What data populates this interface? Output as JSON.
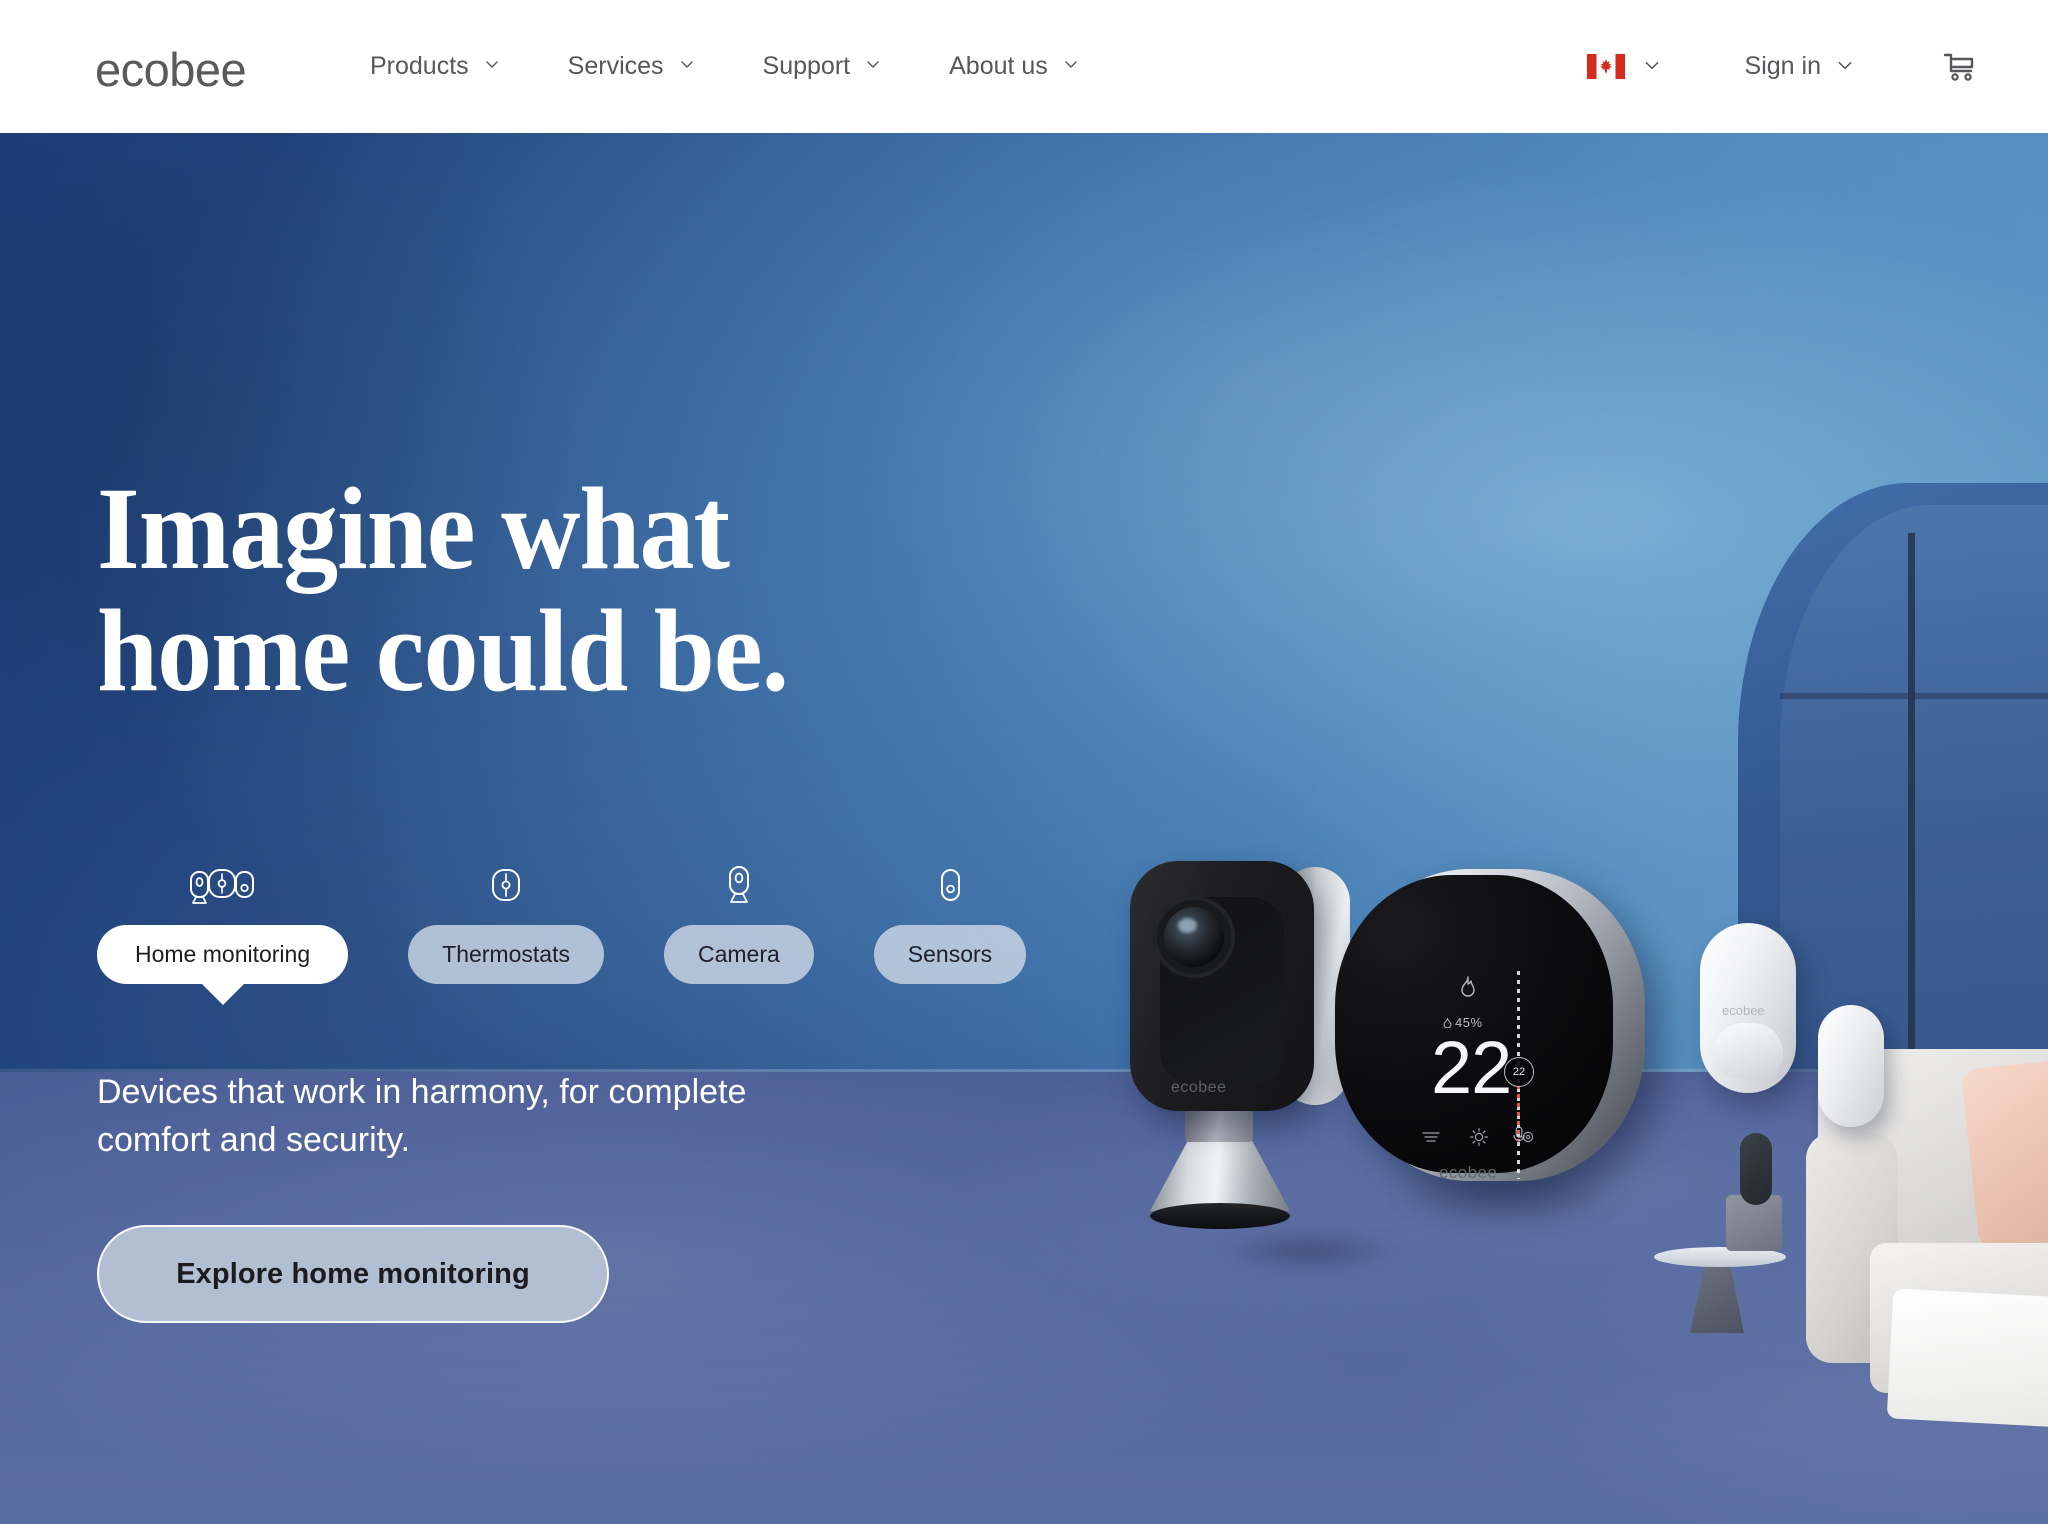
{
  "brand": {
    "name": "ecobee"
  },
  "header": {
    "nav": [
      {
        "label": "Products",
        "icon": "chevron-down-icon"
      },
      {
        "label": "Services",
        "icon": "chevron-down-icon"
      },
      {
        "label": "Support",
        "icon": "chevron-down-icon"
      },
      {
        "label": "About us",
        "icon": "chevron-down-icon"
      }
    ],
    "region": {
      "label": "Canada",
      "icon": "canada-flag-icon",
      "chevron": "chevron-down-icon"
    },
    "signin": {
      "label": "Sign in",
      "chevron": "chevron-down-icon"
    },
    "cart": {
      "icon": "shopping-cart-icon"
    }
  },
  "hero": {
    "headline": "Imagine what\nhome could be.",
    "subhead": "Devices that work in harmony, for complete\ncomfort and security.",
    "cta_label": "Explore home monitoring",
    "categories": [
      {
        "label": "Home monitoring",
        "icon": "home-monitoring-devices-icon",
        "active": true
      },
      {
        "label": "Thermostats",
        "icon": "thermostat-icon",
        "active": false
      },
      {
        "label": "Camera",
        "icon": "camera-icon",
        "active": false
      },
      {
        "label": "Sensors",
        "icon": "sensor-icon",
        "active": false
      }
    ]
  },
  "products": {
    "camera": {
      "name": "SmartCamera",
      "brand_text": "ecobee"
    },
    "thermostat": {
      "name": "Smart Thermostat",
      "brand_text": "ecobee",
      "temperature": "22",
      "humidity": "45%",
      "setpoint": "22",
      "mode_icon": "flame-icon",
      "controls": [
        "menu-icon",
        "sun-icon",
        "settings-icon",
        "microphone-icon"
      ]
    },
    "sensor": {
      "name": "SmartSensor",
      "brand_text": "ecobee"
    }
  },
  "colors": {
    "wall_dark": "#1d3e79",
    "wall_light": "#5b93c3",
    "floor": "#4a5d96",
    "pill_active_bg": "#ffffff",
    "pill_inactive_bg": "#b9c3d4",
    "cta_bg": "#bac5d6",
    "text_dark": "#57565a",
    "flag_red": "#d52b1e"
  }
}
